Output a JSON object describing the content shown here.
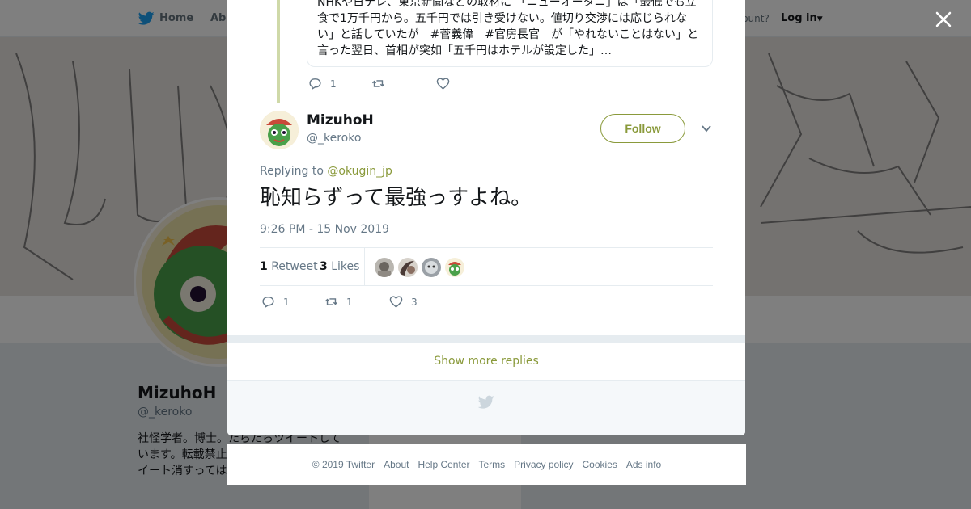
{
  "nav": {
    "home_label": "Home",
    "about_label": "Abo",
    "account_label": "ccount?",
    "login_label": "Log in"
  },
  "profile": {
    "name": "MizuhoH",
    "handle": "@_keroko",
    "bio": "社怪学者。博士。たらたらツイートしています。転載禁止 たち」(青弓社)ア らツイート消すっては。"
  },
  "previous_tweet": {
    "quote_text": "NHKや日テレ、東京新聞などの取材に 「ニューオータニ」は「最低でも立食で1万千円から。五千円では引き受けない。値切り交渉には応じられない」と話していたが　#菅義偉　#官房長官　が「やれないことはない」と言った翌日、首相が突如「五千円はホテルが設定した」…",
    "reply_count": "1",
    "retweet_count": "",
    "like_count": ""
  },
  "tweet": {
    "author_name": "MizuhoH",
    "author_handle": "@_keroko",
    "follow_label": "Follow",
    "replying_prefix": "Replying to",
    "replying_to": "@okugin_jp",
    "text": "恥知らずって最強っすよね。",
    "timestamp": "9:26 PM - 15 Nov 2019",
    "retweets_count": "1",
    "retweets_label": "Retweet",
    "likes_count": "3",
    "likes_label": "Likes",
    "reply_count": "1",
    "retweet_count": "1",
    "like_count": "3"
  },
  "show_more_label": "Show more replies",
  "footer": {
    "copyright": "© 2019 Twitter",
    "links": [
      "About",
      "Help Center",
      "Terms",
      "Privacy policy",
      "Cookies",
      "Ads info"
    ]
  },
  "colors": {
    "accent": "#8a9a3b",
    "overlay": "rgba(0,0,0,0.5)",
    "thread_line": "#cfd9a8"
  },
  "icons": {
    "close": "close-icon",
    "reply": "reply-icon",
    "retweet": "retweet-icon",
    "like": "heart-icon",
    "caret": "chevron-down-icon",
    "bird": "twitter-bird-icon"
  }
}
